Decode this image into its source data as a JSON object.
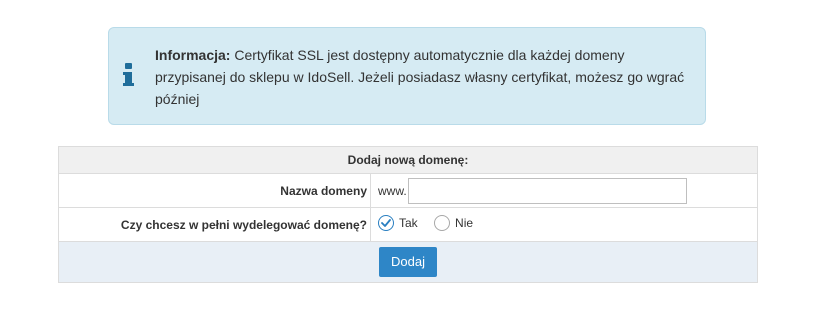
{
  "info": {
    "title": "Informacja:",
    "message": " Certyfikat SSL jest dostępny automatycznie dla każdej domeny przypisanej do sklepu w IdoSell. Jeżeli posiadasz własny certyfikat, możesz go wgrać później",
    "icon": "info-icon"
  },
  "form": {
    "header": "Dodaj nową domenę:",
    "domain_label": "Nazwa domeny",
    "domain_prefix": "www.",
    "domain_value": "",
    "domain_placeholder": "",
    "delegate_label": "Czy chcesz w pełni wydelegować domenę?",
    "options": [
      {
        "label": "Tak",
        "checked": true
      },
      {
        "label": "Nie",
        "checked": false
      }
    ],
    "submit_label": "Dodaj"
  },
  "colors": {
    "info_bg": "#d6ebf3",
    "info_icon": "#1f6d9a",
    "accent": "#2e86c7",
    "submit_row_bg": "#e8eff6",
    "header_bg": "#f0f0f0"
  }
}
